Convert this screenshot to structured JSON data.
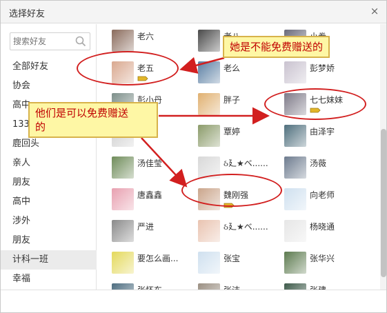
{
  "dialog": {
    "title": "选择好友",
    "close_symbol": "×"
  },
  "search": {
    "placeholder": "搜索好友"
  },
  "groups": [
    "全部好友",
    "协会",
    "高中",
    "133",
    "鹿回头",
    "亲人",
    "朋友",
    "高中",
    "涉外",
    "朋友",
    "计科一班",
    "幸福"
  ],
  "active_group": "计科一班",
  "friends": [
    {
      "name": "老六",
      "avatar_color": "#8a6b5c"
    },
    {
      "name": "老八",
      "avatar_color": "#4a4a4a"
    },
    {
      "name": "小卷",
      "avatar_color": "#6a6a7a"
    },
    {
      "name": "老五",
      "avatar_color": "#d9a88f",
      "gift": true
    },
    {
      "name": "老么",
      "avatar_color": "#5b7fa3"
    },
    {
      "name": "彭梦娇",
      "avatar_color": "#c9c2cf"
    },
    {
      "name": "彭小丹",
      "avatar_color": "#7d8f8a"
    },
    {
      "name": "胖子",
      "avatar_color": "#e0b070"
    },
    {
      "name": "七七妹妹",
      "avatar_color": "#7e7a88",
      "gift": true
    },
    {
      "name": "",
      "avatar_color": "#cfcfcf"
    },
    {
      "name": "覃婷",
      "avatar_color": "#8b9b6a"
    },
    {
      "name": "由泽宇",
      "avatar_color": "#4f6f7d"
    },
    {
      "name": "汤佳莹",
      "avatar_color": "#6f8c5a"
    },
    {
      "name": "ઠ廴★ベ......",
      "avatar_color": "#d8d8d8"
    },
    {
      "name": "汤薇",
      "avatar_color": "#6d7b8e"
    },
    {
      "name": "唐鑫鑫",
      "avatar_color": "#e8a0b0"
    },
    {
      "name": "魏刚强",
      "avatar_color": "#caa58b",
      "gift": true
    },
    {
      "name": "向老师",
      "avatar_color": "#cfe0ef"
    },
    {
      "name": "严进",
      "avatar_color": "#8a8a8a"
    },
    {
      "name": "ઠ廴★ベ......",
      "avatar_color": "#e9c3b0"
    },
    {
      "name": "杨晓通",
      "avatar_color": "#e6e6e6"
    },
    {
      "name": "要怎么画...",
      "avatar_color": "#e4d95c"
    },
    {
      "name": "张宝",
      "avatar_color": "#cfe0ef"
    },
    {
      "name": "张华兴",
      "avatar_color": "#5c7a4e"
    },
    {
      "name": "张怀东",
      "avatar_color": "#4d6d80"
    },
    {
      "name": "张洁",
      "avatar_color": "#9a8f82"
    },
    {
      "name": "张建",
      "avatar_color": "#3d5a4a"
    }
  ],
  "annotations": {
    "callout_free": "她是不能免费赠送的",
    "callout_can_line1": "他们是可以免费赠送",
    "callout_can_line2": "的"
  },
  "colors": {
    "annotation_red": "#d21f1f",
    "callout_bg": "#fef7a5",
    "gift": "#e2b62a"
  }
}
